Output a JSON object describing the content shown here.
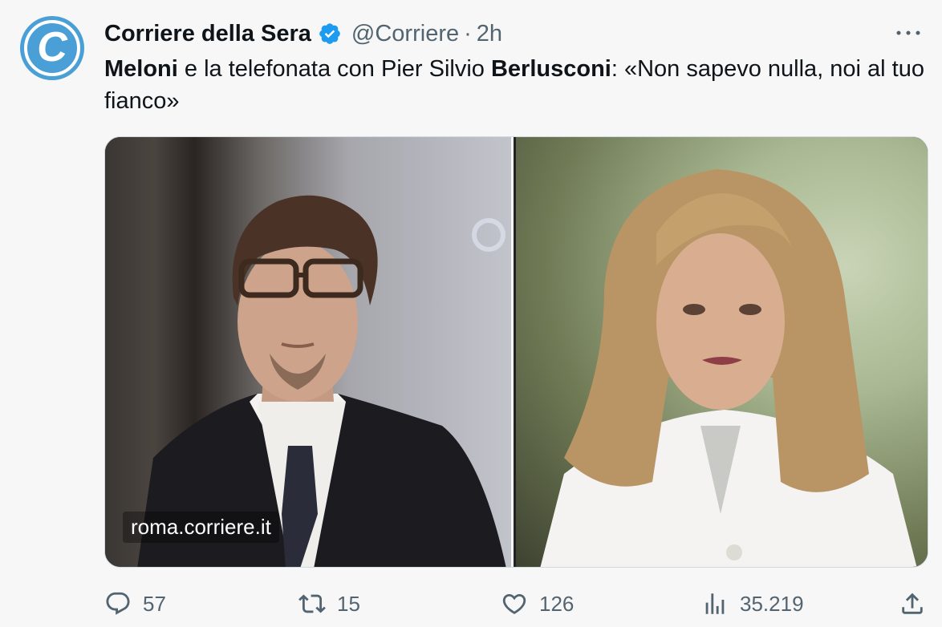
{
  "tweet": {
    "author_name": "Corriere della Sera",
    "handle": "@Corriere",
    "separator": "·",
    "time": "2h",
    "avatar_letter": "C",
    "more_label": "•••",
    "text_parts": [
      {
        "text": "Meloni",
        "bold": true
      },
      {
        "text": " e la telefonata con Pier Silvio ",
        "bold": false
      },
      {
        "text": "Berlusconi",
        "bold": true
      },
      {
        "text": ": «Non sapevo nulla, noi al tuo fianco»",
        "bold": false
      }
    ],
    "media": {
      "source_label": "roma.corriere.it"
    },
    "actions": {
      "replies": "57",
      "retweets": "15",
      "likes": "126",
      "views": "35.219"
    }
  },
  "colors": {
    "brand_blue": "#4a9fd6",
    "verified_blue": "#1d9bf0",
    "muted_text": "#536471",
    "background": "#f7f7f7"
  },
  "icons": {
    "reply": "reply-icon",
    "retweet": "retweet-icon",
    "like": "heart-icon",
    "views": "views-chart-icon",
    "share": "share-icon",
    "verified": "verified-badge-icon",
    "more": "more-dots-icon"
  }
}
